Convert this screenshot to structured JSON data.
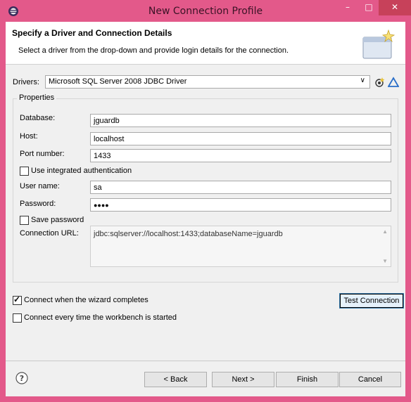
{
  "window": {
    "title": "New Connection Profile",
    "minimize": "–",
    "maximize": "□",
    "close": "✕"
  },
  "header": {
    "title": "Specify a Driver and Connection Details",
    "description": "Select a driver from the drop-down and provide login details for the connection."
  },
  "drivers": {
    "label": "Drivers:",
    "selected": "Microsoft SQL Server 2008 JDBC Driver"
  },
  "properties": {
    "legend": "Properties",
    "database": {
      "label": "Database:",
      "value": "jguardb"
    },
    "host": {
      "label": "Host:",
      "value": "localhost"
    },
    "port": {
      "label": "Port number:",
      "value": "1433"
    },
    "integrated_auth": {
      "label": "Use integrated authentication",
      "checked": false
    },
    "user": {
      "label": "User name:",
      "value": "sa"
    },
    "password": {
      "label": "Password:",
      "value": "●●●●"
    },
    "save_password": {
      "label": "Save password",
      "checked": false
    },
    "url": {
      "label": "Connection URL:",
      "value": "jdbc:sqlserver://localhost:1433;databaseName=jguardb"
    }
  },
  "options": {
    "connect_on_finish": {
      "label": "Connect when the wizard completes",
      "checked": true
    },
    "connect_every_time": {
      "label": "Connect every time the workbench is started",
      "checked": false
    }
  },
  "buttons": {
    "test_connection": "Test Connection",
    "back": "< Back",
    "next": "Next >",
    "finish": "Finish",
    "cancel": "Cancel"
  },
  "colors": {
    "title_bar": "#e3598a",
    "close_button": "#c7415a",
    "dialog_bg": "#f0f0f0"
  }
}
